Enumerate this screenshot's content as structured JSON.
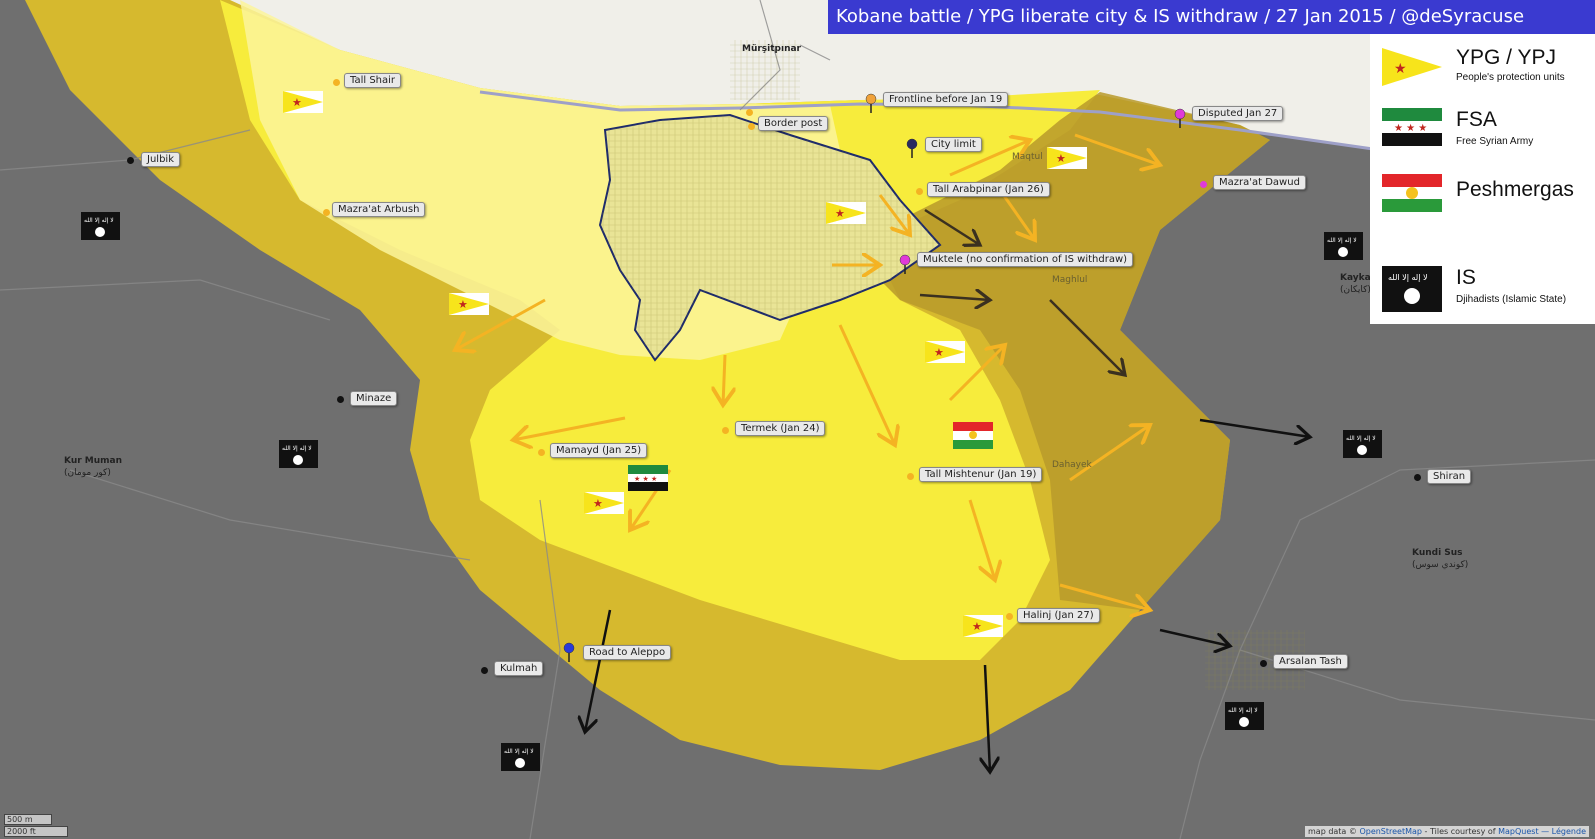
{
  "title": "Kobane battle / YPG liberate city & IS withdraw / 27 Jan 2015 / @deSyracuse",
  "legend": [
    {
      "name": "YPG / YPJ",
      "sub": "People's protection units",
      "flag": "ypg"
    },
    {
      "name": "FSA",
      "sub": "Free Syrian Army",
      "flag": "fsa"
    },
    {
      "name": "Peshmergas",
      "sub": "",
      "flag": "peshmerga"
    },
    {
      "name": "IS",
      "sub": "Djihadists (Islamic State)",
      "flag": "is"
    }
  ],
  "is_flag_text": "لا إله إلا الله",
  "labels": {
    "tall_shair": "Tall Shair",
    "julbik": "Julbik",
    "mazraat_arbush": "Mazra'at Arbush",
    "border_post": "Border post",
    "frontline": "Frontline before Jan 19",
    "city_limit": "City limit",
    "tall_arabpinar": "Tall Arabpinar (Jan 26)",
    "disputed": "Disputed Jan 27",
    "mazraat_dawud": "Mazra'at Dawud",
    "muktele": "Muktele (no confirmation of IS withdraw)",
    "minaze": "Minaze",
    "termek": "Termek (Jan 24)",
    "mamayd": "Mamayd (Jan 25)",
    "tall_mishtenur": "Tall Mishtenur (Jan 19)",
    "shiran": "Shiran",
    "halinj": "Halinj (Jan 27)",
    "road_to_aleppo": "Road to Aleppo",
    "kulmah": "Kulmah",
    "arsalan_tash": "Arsalan Tash"
  },
  "plain_labels": {
    "mursitpinar": "Mürşitpınar",
    "kur_muman": "Kur Muman",
    "kur_muman_ar": "(كور مومان)",
    "kundi_sus": "Kundi Sus",
    "kundi_sus_ar": "(كوندي سوس)",
    "kaykan": "Kaykan",
    "kaykan_ar": "(كايكان)",
    "maqtul": "Maqtul",
    "maghlul": "Maghlul",
    "dahayek": "Dahayek"
  },
  "scale": {
    "m": "500 m",
    "ft": "2000 ft"
  },
  "credit": {
    "prefix": "map data ©",
    "osm": "OpenStreetMap",
    "mid": "- Tiles courtesy of",
    "mq": "MapQuest",
    "legend": "— Légende"
  },
  "colors": {
    "ypg_zone": "#f7ec3c",
    "ypg_zone_light": "#fbf59b",
    "contested_zone": "#d6b92e",
    "is_zone": "#6f6f6f",
    "turkey": "#f0efe9",
    "ypg_arrow": "#f4b323",
    "is_arrow": "#111111",
    "title_bg": "#3a3ad0"
  }
}
